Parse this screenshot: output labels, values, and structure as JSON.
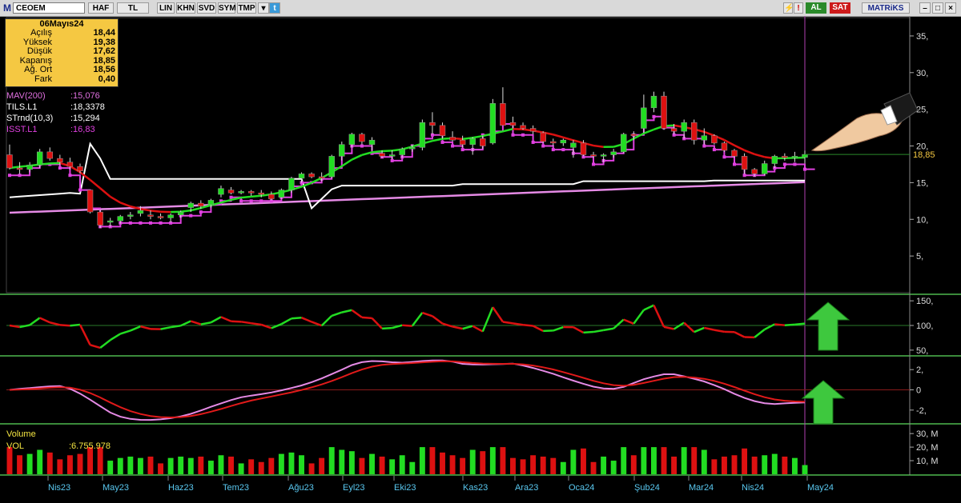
{
  "toolbar": {
    "symbol": "CEOEM",
    "period": "HAF",
    "currency": "TL",
    "buttons": [
      "LIN",
      "KHN",
      "SVD",
      "SYM",
      "TMP"
    ],
    "buy_label": "AL",
    "sell_label": "SAT",
    "brand": "MATRiKS"
  },
  "info_box": {
    "date": "06Mayıs24",
    "rows": [
      {
        "label": "Açılış",
        "value": "18,44"
      },
      {
        "label": "Yüksek",
        "value": "19,38"
      },
      {
        "label": "Düşük",
        "value": "17,62"
      },
      {
        "label": "Kapanış",
        "value": "18,85"
      },
      {
        "label": "Ağ. Ort",
        "value": "18,56"
      },
      {
        "label": "Fark",
        "value": "0,40"
      }
    ]
  },
  "indicators": [
    {
      "name": "MAV(200)",
      "value": ":15,076",
      "color": "#e070e0"
    },
    {
      "name": "TILS.L1",
      "value": ":18,3378",
      "color": "#ffffff"
    },
    {
      "name": "STrnd(10,3)",
      "value": ":15,294",
      "color": "#ffffff"
    },
    {
      "name": "ISST.L1",
      "value": ":16,83",
      "color": "#e040e0"
    }
  ],
  "price_axis": {
    "ticks": [
      "35,",
      "30,",
      "25,",
      "20,",
      "15,",
      "10,",
      "5,"
    ],
    "last_price": "18,85"
  },
  "osc1_axis": {
    "ticks": [
      "150,",
      "100,",
      "50,"
    ]
  },
  "osc2_axis": {
    "ticks": [
      "2,",
      "0",
      "-2,"
    ]
  },
  "volume": {
    "title": "Volume",
    "name": "VOL",
    "value": ":6.755.978",
    "ticks": [
      "30, M",
      "20, M",
      "10, M"
    ]
  },
  "time_axis": [
    "Nis23",
    "May23",
    "Haz23",
    "Tem23",
    "Ağu23",
    "Eyl23",
    "Eki23",
    "Kas23",
    "Ara23",
    "Oca24",
    "Şub24",
    "Mar24",
    "Nis24",
    "May24"
  ],
  "colors": {
    "up": "#22dd22",
    "down": "#dd1111",
    "accent": "#f5c842"
  },
  "chart_data": {
    "type": "candlestick",
    "candles": [
      [
        18.8,
        20.2,
        16.8,
        17.0
      ],
      [
        17.0,
        17.8,
        16.2,
        16.8
      ],
      [
        16.8,
        17.8,
        16.4,
        17.4
      ],
      [
        17.4,
        19.6,
        17.0,
        19.2
      ],
      [
        19.2,
        19.8,
        18.0,
        18.3
      ],
      [
        18.3,
        18.8,
        17.4,
        17.8
      ],
      [
        17.8,
        18.4,
        16.8,
        17.2
      ],
      [
        17.2,
        17.6,
        16.2,
        16.6
      ],
      [
        14.0,
        14.0,
        10.8,
        11.0
      ],
      [
        11.0,
        11.4,
        8.8,
        9.2
      ],
      [
        9.6,
        10.2,
        9.0,
        9.8
      ],
      [
        9.8,
        10.6,
        9.4,
        10.4
      ],
      [
        10.4,
        11.0,
        10.0,
        10.6
      ],
      [
        10.8,
        11.8,
        10.4,
        11.2
      ],
      [
        10.6,
        11.2,
        10.0,
        10.4
      ],
      [
        10.4,
        10.8,
        10.0,
        10.2
      ],
      [
        10.2,
        10.8,
        9.6,
        10.6
      ],
      [
        10.6,
        11.2,
        10.2,
        11.0
      ],
      [
        11.6,
        12.4,
        11.0,
        12.2
      ],
      [
        12.2,
        12.6,
        11.4,
        11.8
      ],
      [
        12.0,
        12.8,
        11.6,
        12.6
      ],
      [
        13.4,
        14.6,
        13.0,
        14.2
      ],
      [
        14.0,
        14.4,
        13.4,
        13.6
      ],
      [
        13.6,
        14.0,
        13.4,
        13.8
      ],
      [
        13.8,
        14.0,
        13.2,
        13.6
      ],
      [
        13.6,
        14.0,
        13.0,
        13.4
      ],
      [
        13.4,
        13.8,
        12.6,
        12.8
      ],
      [
        13.0,
        14.2,
        12.8,
        14.0
      ],
      [
        14.0,
        15.8,
        13.6,
        15.6
      ],
      [
        15.6,
        16.4,
        15.0,
        16.2
      ],
      [
        16.2,
        16.4,
        15.6,
        15.8
      ],
      [
        15.8,
        16.4,
        15.2,
        15.6
      ],
      [
        15.8,
        18.8,
        15.6,
        18.6
      ],
      [
        18.6,
        20.6,
        18.0,
        20.2
      ],
      [
        20.2,
        21.8,
        19.8,
        21.6
      ],
      [
        21.6,
        21.8,
        20.2,
        20.6
      ],
      [
        20.2,
        21.2,
        19.4,
        20.8
      ],
      [
        19.0,
        19.4,
        18.4,
        18.6
      ],
      [
        18.6,
        19.4,
        18.2,
        18.8
      ],
      [
        18.8,
        19.8,
        18.4,
        19.6
      ],
      [
        19.6,
        20.2,
        19.2,
        19.8
      ],
      [
        19.8,
        23.6,
        19.4,
        23.2
      ],
      [
        23.2,
        24.6,
        21.6,
        22.8
      ],
      [
        22.8,
        23.2,
        21.0,
        21.4
      ],
      [
        21.2,
        22.0,
        20.6,
        20.8
      ],
      [
        20.8,
        21.4,
        19.8,
        20.2
      ],
      [
        20.2,
        21.2,
        18.8,
        21.0
      ],
      [
        21.0,
        21.4,
        19.6,
        20.0
      ],
      [
        20.4,
        26.4,
        20.2,
        25.8
      ],
      [
        25.8,
        28.0,
        22.8,
        22.8
      ],
      [
        23.2,
        24.0,
        22.4,
        22.8
      ],
      [
        22.8,
        23.2,
        22.2,
        22.4
      ],
      [
        22.4,
        22.8,
        21.6,
        22.0
      ],
      [
        21.8,
        22.0,
        20.4,
        20.6
      ],
      [
        20.6,
        21.0,
        20.0,
        20.4
      ],
      [
        20.4,
        21.0,
        20.0,
        20.8
      ],
      [
        19.8,
        20.8,
        18.4,
        20.4
      ],
      [
        20.4,
        20.8,
        18.6,
        18.8
      ],
      [
        18.8,
        19.2,
        18.4,
        18.6
      ],
      [
        18.6,
        19.0,
        17.8,
        18.8
      ],
      [
        18.8,
        19.6,
        18.4,
        19.2
      ],
      [
        19.2,
        21.8,
        19.0,
        21.6
      ],
      [
        21.6,
        22.0,
        20.8,
        21.4
      ],
      [
        22.4,
        27.0,
        21.8,
        25.2
      ],
      [
        25.2,
        27.4,
        24.6,
        26.8
      ],
      [
        26.8,
        27.4,
        22.2,
        22.4
      ],
      [
        22.4,
        23.0,
        21.6,
        22.0
      ],
      [
        22.0,
        23.6,
        21.0,
        23.2
      ],
      [
        23.2,
        23.6,
        20.2,
        20.8
      ],
      [
        20.8,
        22.4,
        20.2,
        21.4
      ],
      [
        21.4,
        21.6,
        20.2,
        20.4
      ],
      [
        20.4,
        20.6,
        19.2,
        19.4
      ],
      [
        19.4,
        19.6,
        18.4,
        18.6
      ],
      [
        18.6,
        19.0,
        16.2,
        16.8
      ],
      [
        16.8,
        17.0,
        15.8,
        16.2
      ],
      [
        16.2,
        18.0,
        16.0,
        17.6
      ],
      [
        17.6,
        18.8,
        17.0,
        18.6
      ],
      [
        18.6,
        19.0,
        18.0,
        18.4
      ],
      [
        18.4,
        19.2,
        17.8,
        18.6
      ],
      [
        18.44,
        19.38,
        17.62,
        18.85
      ]
    ]
  }
}
